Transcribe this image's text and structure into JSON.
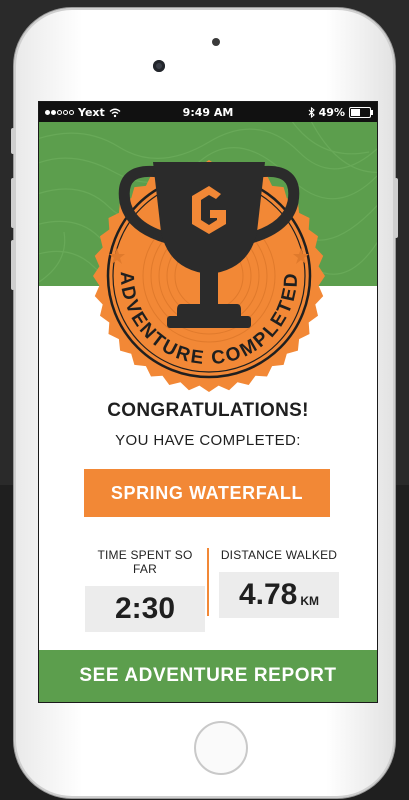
{
  "status_bar": {
    "carrier": "Yext",
    "time": "9:49 AM",
    "battery": "49%",
    "battery_level": 0.49
  },
  "badge": {
    "arc_text": "ADVENTURE COMPLETED",
    "logo_letter": "G"
  },
  "headline": "CONGRATULATIONS!",
  "subheadline": "YOU HAVE COMPLETED:",
  "adventure_name": "SPRING WATERFALL",
  "stats": {
    "time_label": "TIME SPENT SO FAR",
    "time_value": "2:30",
    "distance_label": "DISTANCE WALKED",
    "distance_value": "4.78",
    "distance_unit": "KM"
  },
  "report_button": "SEE ADVENTURE REPORT",
  "colors": {
    "green": "#5c9e4d",
    "orange": "#f28836",
    "dark": "#1f1f1f"
  },
  "icons": [
    "wifi-icon",
    "bluetooth-icon",
    "battery-icon",
    "trophy-icon",
    "star-icon"
  ]
}
